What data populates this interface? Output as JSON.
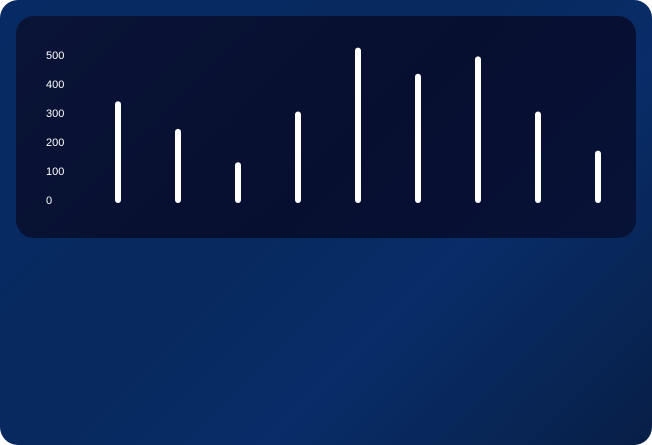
{
  "chart_data": {
    "type": "bar",
    "categories": [
      "",
      "",
      "",
      "",
      "",
      "",
      "",
      "",
      ""
    ],
    "values": [
      330,
      235,
      120,
      295,
      515,
      425,
      485,
      295,
      160
    ],
    "title": "",
    "xlabel": "",
    "ylabel": "",
    "ylim": [
      0,
      500
    ],
    "yticks": [
      "0",
      "100",
      "200",
      "300",
      "400",
      "500"
    ],
    "grid": false,
    "bar_color": "#ffffff"
  },
  "colors": {
    "background": "#062a63",
    "panel": "#0a1436",
    "bar": "#ffffff"
  }
}
